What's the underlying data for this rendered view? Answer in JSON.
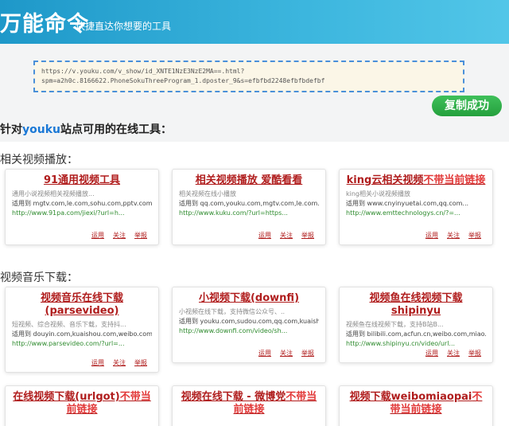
{
  "header": {
    "logo": "万能命令",
    "slogan": "快捷直达你想要的工具"
  },
  "url_box": {
    "value": "https://v.youku.com/v_show/id_XNTE1NzE3NzE2MA==.html?\nspm=a2h0c.8166622.PhoneSokuThreeProgram_1.dposter_9&s=efbfbd2248efbfbdefbf"
  },
  "copy_button": {
    "label": "复制成功",
    "color": "#2fb34a"
  },
  "tools_title": {
    "prefix": "针对",
    "brand": "youku",
    "suffix": "站点可用的在线工具："
  },
  "sections": [
    {
      "title": "相关视频播放：",
      "cards": [
        {
          "title": "91通用视频工具",
          "title_bad": "",
          "desc": "通用小说视频相关视频播放...",
          "sample": "适用到 mgtv.com,le.com,sohu.com,pptv.com...",
          "link": "http://www.91pa.com/jiexi/?url=h...",
          "links": [
            "运用",
            "关注",
            "举报"
          ]
        },
        {
          "title": "相关视频播放 爱酷看看",
          "title_bad": "",
          "desc": "相关视频在线小播放",
          "sample": "适用到 qq.com,youku.com,mgtv.com,le.com...",
          "link": "http://www.kuku.com/?url=https...",
          "links": [
            "运用",
            "关注",
            "举报"
          ]
        },
        {
          "title": "king云相关视频",
          "title_bad": "不带当前链接",
          "desc": "king相关小说视频播放",
          "sample": "适用到 www.cnyinyuetai.com,qq.com...",
          "link": "http://www.emttechnologys.cn/?=...",
          "links": [
            "运用",
            "关注",
            "举报"
          ]
        }
      ]
    },
    {
      "title": "视频音乐下载：",
      "cards": [
        {
          "title": "视频音乐在线下载(parsevideo)",
          "title_bad": "",
          "desc": "短视频、综合视频、音乐下载，支持抖...",
          "sample": "适用到 douyin.com,kuaishou.com,weibo.com...",
          "link": "http://www.parsevideo.com/?url=...",
          "links": [
            "运用",
            "关注",
            "举报"
          ]
        },
        {
          "title": "小视频下载(downfi)",
          "title_bad": "",
          "desc": "小视频在线下载，支持微信公众号、..",
          "sample": "适用到 youku.com,sudou.com,qq.com,kuaish...",
          "link": "http://www.downfi.com/video/sh...",
          "links": [
            "运用",
            "关注",
            "举报"
          ]
        },
        {
          "title": "视频鱼在线视频下载shipinyu",
          "title_bad": "",
          "desc": "视频鱼在线视频下载，支持B站B...",
          "sample": "适用到 bilibili.com,acfun.cn,weibo.com,miao...",
          "link": "http://www.shipinyu.cn/video/url...",
          "links": [
            "运用",
            "关注",
            "举报"
          ]
        }
      ]
    },
    {
      "title": "",
      "cards": [
        {
          "title": "在线视频下载(urlgot)",
          "title_bad": "不带当前链接",
          "desc": "",
          "sample": "",
          "link": "",
          "links": []
        },
        {
          "title": "视频在线下载 - 微博党",
          "title_bad": "不带当前链接",
          "desc": "",
          "sample": "",
          "link": "",
          "links": []
        },
        {
          "title": "视频下载weibomiaopai",
          "title_bad": "不带当前链接",
          "desc": "",
          "sample": "",
          "link": "",
          "links": []
        }
      ]
    }
  ]
}
